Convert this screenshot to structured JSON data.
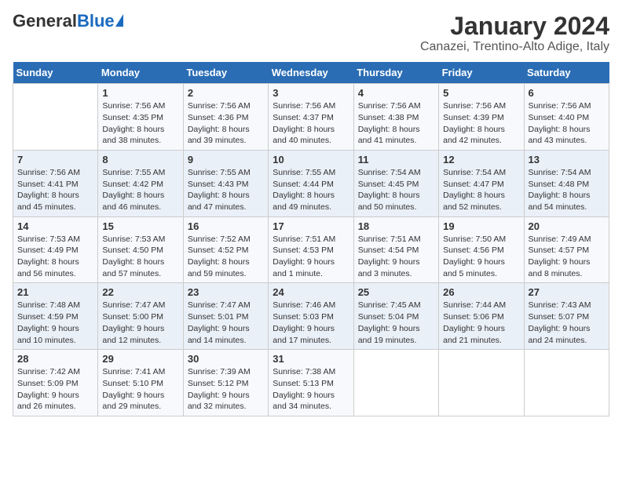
{
  "header": {
    "logo_general": "General",
    "logo_blue": "Blue",
    "title": "January 2024",
    "subtitle": "Canazei, Trentino-Alto Adige, Italy"
  },
  "days_of_week": [
    "Sunday",
    "Monday",
    "Tuesday",
    "Wednesday",
    "Thursday",
    "Friday",
    "Saturday"
  ],
  "weeks": [
    [
      {
        "day": "",
        "sunrise": "",
        "sunset": "",
        "daylight": ""
      },
      {
        "day": "1",
        "sunrise": "Sunrise: 7:56 AM",
        "sunset": "Sunset: 4:35 PM",
        "daylight": "Daylight: 8 hours and 38 minutes."
      },
      {
        "day": "2",
        "sunrise": "Sunrise: 7:56 AM",
        "sunset": "Sunset: 4:36 PM",
        "daylight": "Daylight: 8 hours and 39 minutes."
      },
      {
        "day": "3",
        "sunrise": "Sunrise: 7:56 AM",
        "sunset": "Sunset: 4:37 PM",
        "daylight": "Daylight: 8 hours and 40 minutes."
      },
      {
        "day": "4",
        "sunrise": "Sunrise: 7:56 AM",
        "sunset": "Sunset: 4:38 PM",
        "daylight": "Daylight: 8 hours and 41 minutes."
      },
      {
        "day": "5",
        "sunrise": "Sunrise: 7:56 AM",
        "sunset": "Sunset: 4:39 PM",
        "daylight": "Daylight: 8 hours and 42 minutes."
      },
      {
        "day": "6",
        "sunrise": "Sunrise: 7:56 AM",
        "sunset": "Sunset: 4:40 PM",
        "daylight": "Daylight: 8 hours and 43 minutes."
      }
    ],
    [
      {
        "day": "7",
        "sunrise": "Sunrise: 7:56 AM",
        "sunset": "Sunset: 4:41 PM",
        "daylight": "Daylight: 8 hours and 45 minutes."
      },
      {
        "day": "8",
        "sunrise": "Sunrise: 7:55 AM",
        "sunset": "Sunset: 4:42 PM",
        "daylight": "Daylight: 8 hours and 46 minutes."
      },
      {
        "day": "9",
        "sunrise": "Sunrise: 7:55 AM",
        "sunset": "Sunset: 4:43 PM",
        "daylight": "Daylight: 8 hours and 47 minutes."
      },
      {
        "day": "10",
        "sunrise": "Sunrise: 7:55 AM",
        "sunset": "Sunset: 4:44 PM",
        "daylight": "Daylight: 8 hours and 49 minutes."
      },
      {
        "day": "11",
        "sunrise": "Sunrise: 7:54 AM",
        "sunset": "Sunset: 4:45 PM",
        "daylight": "Daylight: 8 hours and 50 minutes."
      },
      {
        "day": "12",
        "sunrise": "Sunrise: 7:54 AM",
        "sunset": "Sunset: 4:47 PM",
        "daylight": "Daylight: 8 hours and 52 minutes."
      },
      {
        "day": "13",
        "sunrise": "Sunrise: 7:54 AM",
        "sunset": "Sunset: 4:48 PM",
        "daylight": "Daylight: 8 hours and 54 minutes."
      }
    ],
    [
      {
        "day": "14",
        "sunrise": "Sunrise: 7:53 AM",
        "sunset": "Sunset: 4:49 PM",
        "daylight": "Daylight: 8 hours and 56 minutes."
      },
      {
        "day": "15",
        "sunrise": "Sunrise: 7:53 AM",
        "sunset": "Sunset: 4:50 PM",
        "daylight": "Daylight: 8 hours and 57 minutes."
      },
      {
        "day": "16",
        "sunrise": "Sunrise: 7:52 AM",
        "sunset": "Sunset: 4:52 PM",
        "daylight": "Daylight: 8 hours and 59 minutes."
      },
      {
        "day": "17",
        "sunrise": "Sunrise: 7:51 AM",
        "sunset": "Sunset: 4:53 PM",
        "daylight": "Daylight: 9 hours and 1 minute."
      },
      {
        "day": "18",
        "sunrise": "Sunrise: 7:51 AM",
        "sunset": "Sunset: 4:54 PM",
        "daylight": "Daylight: 9 hours and 3 minutes."
      },
      {
        "day": "19",
        "sunrise": "Sunrise: 7:50 AM",
        "sunset": "Sunset: 4:56 PM",
        "daylight": "Daylight: 9 hours and 5 minutes."
      },
      {
        "day": "20",
        "sunrise": "Sunrise: 7:49 AM",
        "sunset": "Sunset: 4:57 PM",
        "daylight": "Daylight: 9 hours and 8 minutes."
      }
    ],
    [
      {
        "day": "21",
        "sunrise": "Sunrise: 7:48 AM",
        "sunset": "Sunset: 4:59 PM",
        "daylight": "Daylight: 9 hours and 10 minutes."
      },
      {
        "day": "22",
        "sunrise": "Sunrise: 7:47 AM",
        "sunset": "Sunset: 5:00 PM",
        "daylight": "Daylight: 9 hours and 12 minutes."
      },
      {
        "day": "23",
        "sunrise": "Sunrise: 7:47 AM",
        "sunset": "Sunset: 5:01 PM",
        "daylight": "Daylight: 9 hours and 14 minutes."
      },
      {
        "day": "24",
        "sunrise": "Sunrise: 7:46 AM",
        "sunset": "Sunset: 5:03 PM",
        "daylight": "Daylight: 9 hours and 17 minutes."
      },
      {
        "day": "25",
        "sunrise": "Sunrise: 7:45 AM",
        "sunset": "Sunset: 5:04 PM",
        "daylight": "Daylight: 9 hours and 19 minutes."
      },
      {
        "day": "26",
        "sunrise": "Sunrise: 7:44 AM",
        "sunset": "Sunset: 5:06 PM",
        "daylight": "Daylight: 9 hours and 21 minutes."
      },
      {
        "day": "27",
        "sunrise": "Sunrise: 7:43 AM",
        "sunset": "Sunset: 5:07 PM",
        "daylight": "Daylight: 9 hours and 24 minutes."
      }
    ],
    [
      {
        "day": "28",
        "sunrise": "Sunrise: 7:42 AM",
        "sunset": "Sunset: 5:09 PM",
        "daylight": "Daylight: 9 hours and 26 minutes."
      },
      {
        "day": "29",
        "sunrise": "Sunrise: 7:41 AM",
        "sunset": "Sunset: 5:10 PM",
        "daylight": "Daylight: 9 hours and 29 minutes."
      },
      {
        "day": "30",
        "sunrise": "Sunrise: 7:39 AM",
        "sunset": "Sunset: 5:12 PM",
        "daylight": "Daylight: 9 hours and 32 minutes."
      },
      {
        "day": "31",
        "sunrise": "Sunrise: 7:38 AM",
        "sunset": "Sunset: 5:13 PM",
        "daylight": "Daylight: 9 hours and 34 minutes."
      },
      {
        "day": "",
        "sunrise": "",
        "sunset": "",
        "daylight": ""
      },
      {
        "day": "",
        "sunrise": "",
        "sunset": "",
        "daylight": ""
      },
      {
        "day": "",
        "sunrise": "",
        "sunset": "",
        "daylight": ""
      }
    ]
  ]
}
